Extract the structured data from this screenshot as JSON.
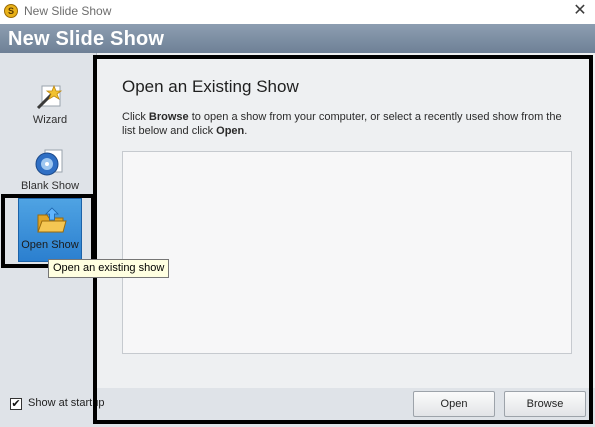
{
  "window": {
    "title": "New Slide Show",
    "close_glyph": "✕",
    "app_icon": "app-logo-icon"
  },
  "header": {
    "title": "New Slide Show"
  },
  "sidebar": {
    "items": [
      {
        "label": "Wizard",
        "icon": "wizard-wand-icon",
        "active": false
      },
      {
        "label": "Blank Show",
        "icon": "blank-show-disc-icon",
        "active": false
      },
      {
        "label": "Open Show",
        "icon": "open-folder-icon",
        "active": true
      }
    ]
  },
  "tooltip": {
    "text": "Open an existing show"
  },
  "main": {
    "heading": "Open an Existing Show",
    "instructions": {
      "part1": "Click ",
      "bold1": "Browse",
      "part2": " to open a show from your computer, or select a recently used show from the list below and click ",
      "bold2": "Open",
      "part3": "."
    },
    "recent_shows": []
  },
  "footer": {
    "show_at_startup_label": "Show at startup",
    "show_at_startup_checked": true,
    "check_glyph": "✔",
    "open_label": "Open",
    "browse_label": "Browse"
  },
  "colors": {
    "header_band": "#7f91a6",
    "sidebar_bg": "#dfe3e8",
    "active_item": "#3a8ed8",
    "tooltip_bg": "#ffffe1",
    "annotation_border": "#000000"
  }
}
